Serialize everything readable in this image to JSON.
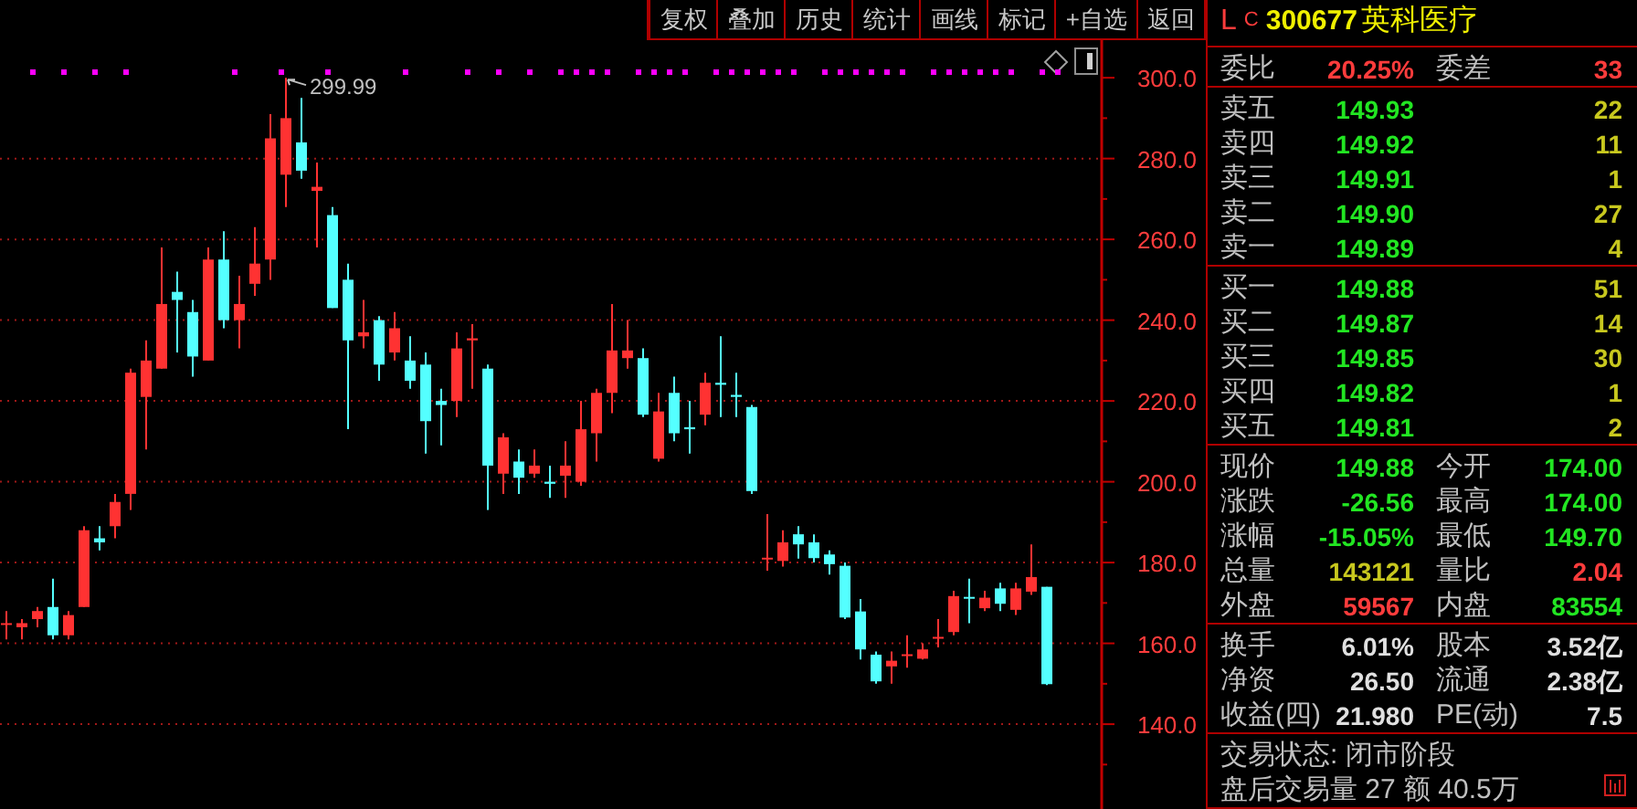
{
  "toolbar": [
    {
      "label": "复权"
    },
    {
      "label": "叠加"
    },
    {
      "label": "历史"
    },
    {
      "label": "统计"
    },
    {
      "label": "画线"
    },
    {
      "label": "标记"
    },
    {
      "label": "+自选"
    },
    {
      "label": "返回"
    }
  ],
  "chart": {
    "peak_label": "299.99",
    "chart_data": {
      "type": "candlestick",
      "ylim": [
        119,
        309.3
      ],
      "grid": true,
      "yticks": [
        {
          "value": 140,
          "label": "140.0"
        },
        {
          "value": 160,
          "label": "160.0"
        },
        {
          "value": 180,
          "label": "180.0"
        },
        {
          "value": 200,
          "label": "200.0"
        },
        {
          "value": 220,
          "label": "220.0"
        },
        {
          "value": 240,
          "label": "240.0"
        },
        {
          "value": 260,
          "label": "260.0"
        },
        {
          "value": 280,
          "label": "280.0"
        },
        {
          "value": 300,
          "label": "300.0"
        }
      ],
      "ohlc": [
        [
          165,
          168,
          161,
          165
        ],
        [
          164,
          166,
          161,
          165
        ],
        [
          166,
          169,
          164,
          168
        ],
        [
          169,
          176,
          161,
          162
        ],
        [
          162,
          168,
          161,
          167
        ],
        [
          169,
          189,
          169,
          188
        ],
        [
          186,
          189,
          183,
          185
        ],
        [
          189,
          197,
          186,
          195
        ],
        [
          197,
          228,
          193,
          227
        ],
        [
          221,
          235,
          208,
          230
        ],
        [
          228,
          258,
          228,
          244
        ],
        [
          247,
          252,
          232,
          245
        ],
        [
          242,
          245,
          226,
          231
        ],
        [
          230,
          258,
          230,
          255
        ],
        [
          255,
          262,
          238,
          240
        ],
        [
          240,
          251,
          233,
          244
        ],
        [
          249,
          263,
          246,
          254
        ],
        [
          255,
          291,
          250,
          285
        ],
        [
          276,
          300,
          268,
          290
        ],
        [
          284,
          295,
          275,
          277
        ],
        [
          272,
          279,
          258,
          273
        ],
        [
          266,
          268,
          243,
          243
        ],
        [
          250,
          254,
          213,
          235
        ],
        [
          236,
          245,
          233,
          237
        ],
        [
          240,
          241,
          225,
          229
        ],
        [
          232,
          242,
          230,
          238
        ],
        [
          230,
          236,
          223,
          225
        ],
        [
          229,
          232,
          207,
          215
        ],
        [
          220,
          223,
          209,
          219
        ],
        [
          220,
          237,
          216,
          233
        ],
        [
          235,
          239,
          223,
          235.5
        ],
        [
          228,
          229,
          193,
          204
        ],
        [
          202,
          212,
          197,
          211
        ],
        [
          205,
          208,
          197,
          201
        ],
        [
          202,
          208,
          201,
          204
        ],
        [
          200,
          204,
          196,
          199.5
        ],
        [
          201.5,
          210,
          196,
          204
        ],
        [
          200,
          220,
          199,
          213
        ],
        [
          212,
          223,
          205,
          222
        ],
        [
          222,
          244,
          217,
          232.5
        ],
        [
          230.6,
          240,
          228,
          232.5
        ],
        [
          230.6,
          233,
          216,
          216.6
        ],
        [
          205.7,
          222,
          205,
          217.4
        ],
        [
          222,
          226,
          210,
          212
        ],
        [
          213.5,
          220,
          207,
          213
        ],
        [
          216.6,
          227,
          214,
          224.5
        ],
        [
          224.5,
          236,
          216,
          224
        ],
        [
          221.5,
          227,
          216,
          221
        ],
        [
          218.5,
          219,
          197,
          197.7
        ],
        [
          181,
          192,
          178,
          181.2
        ],
        [
          180.4,
          188,
          179,
          185
        ],
        [
          187,
          189,
          181,
          184.5
        ],
        [
          185,
          187,
          180,
          181.1
        ],
        [
          182,
          183,
          177,
          179.6
        ],
        [
          179.2,
          180,
          166,
          166.4
        ],
        [
          167.9,
          171,
          156,
          158.5
        ],
        [
          157.2,
          158,
          150,
          150.6
        ],
        [
          154.3,
          158,
          150,
          155.7
        ],
        [
          157,
          162,
          154,
          157.3
        ],
        [
          156.2,
          160,
          156,
          158.5
        ],
        [
          161.3,
          166,
          159,
          161.6
        ],
        [
          162.8,
          173,
          162,
          171.7
        ],
        [
          171.5,
          176,
          165,
          171.2
        ],
        [
          168.7,
          173,
          168,
          171.3
        ],
        [
          173.6,
          175,
          168,
          169.8
        ],
        [
          168.3,
          175,
          167,
          173.6
        ],
        [
          172.8,
          184.5,
          172,
          176.4
        ],
        [
          174,
          174,
          149.7,
          149.9
        ]
      ]
    }
  },
  "quote": {
    "flags": [
      "L",
      "C"
    ],
    "code": "300677",
    "name": "英科医疗"
  },
  "ratio": [
    {
      "label": "委比",
      "value": "20.25%",
      "color": "#ff3c3c"
    },
    {
      "label": "委差",
      "value": "33",
      "color": "#ff3c3c"
    }
  ],
  "sell": [
    {
      "label": "卖五",
      "price": "149.93",
      "volume": "22"
    },
    {
      "label": "卖四",
      "price": "149.92",
      "volume": "11"
    },
    {
      "label": "卖三",
      "price": "149.91",
      "volume": "1"
    },
    {
      "label": "卖二",
      "price": "149.90",
      "volume": "27"
    },
    {
      "label": "卖一",
      "price": "149.89",
      "volume": "4"
    }
  ],
  "buy": [
    {
      "label": "买一",
      "price": "149.88",
      "volume": "51"
    },
    {
      "label": "买二",
      "price": "149.87",
      "volume": "14"
    },
    {
      "label": "买三",
      "price": "149.85",
      "volume": "30"
    },
    {
      "label": "买四",
      "price": "149.82",
      "volume": "1"
    },
    {
      "label": "买五",
      "price": "149.81",
      "volume": "2"
    }
  ],
  "quote_stats": [
    {
      "label": "现价",
      "value": "149.88",
      "color": "#22e622"
    },
    {
      "label": "今开",
      "value": "174.00",
      "color": "#22e622"
    },
    {
      "label": "涨跌",
      "value": "-26.56",
      "color": "#22e622"
    },
    {
      "label": "最高",
      "value": "174.00",
      "color": "#22e622"
    },
    {
      "label": "涨幅",
      "value": "-15.05%",
      "color": "#22e622"
    },
    {
      "label": "最低",
      "value": "149.70",
      "color": "#22e622"
    },
    {
      "label": "总量",
      "value": "143121",
      "color": "#c8c81e"
    },
    {
      "label": "量比",
      "value": "2.04",
      "color": "#ff3c3c"
    },
    {
      "label": "外盘",
      "value": "59567",
      "color": "#ff3c3c"
    },
    {
      "label": "内盘",
      "value": "83554",
      "color": "#22e622"
    }
  ],
  "fundamentals": [
    {
      "label": "换手",
      "value": "6.01%"
    },
    {
      "label": "股本",
      "value": "3.52亿"
    },
    {
      "label": "净资",
      "value": "26.50"
    },
    {
      "label": "流通",
      "value": "2.38亿"
    },
    {
      "label": "收益(四)",
      "value": "21.980"
    },
    {
      "label": "PE(动)",
      "value": "7.5"
    }
  ],
  "status_lines": [
    "交易状态: 闭市阶段",
    "盘后交易量 27 额 40.5万"
  ]
}
